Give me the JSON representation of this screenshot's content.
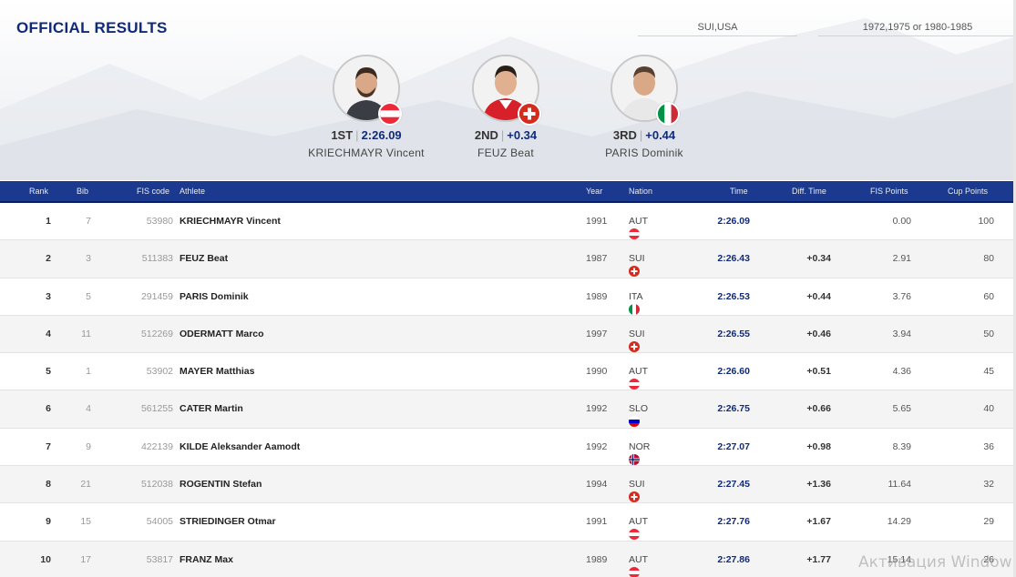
{
  "page_title": "OFFICIAL RESULTS",
  "filters": {
    "nation": "SUI,USA",
    "year": "1972,1975 or 1980-1985"
  },
  "podium": [
    {
      "place": "1ST",
      "value": "2:26.09",
      "name": "KRIECHMAYR Vincent",
      "flag": "flag-austria-icon"
    },
    {
      "place": "2ND",
      "value": "+0.34",
      "name": "FEUZ Beat",
      "flag": "flag-switzerland-icon"
    },
    {
      "place": "3RD",
      "value": "+0.44",
      "name": "PARIS Dominik",
      "flag": "flag-italy-icon"
    }
  ],
  "table": {
    "headers": {
      "rank": "Rank",
      "bib": "Bib",
      "fis_code": "FIS code",
      "athlete": "Athlete",
      "year": "Year",
      "nation": "Nation",
      "time": "Time",
      "diff": "Diff. Time",
      "fis_points": "FIS Points",
      "cup_points": "Cup Points"
    },
    "rows": [
      {
        "rank": "1",
        "bib": "7",
        "fis": "53980",
        "athlete": "KRIECHMAYR Vincent",
        "year": "1991",
        "nation": "AUT",
        "time": "2:26.09",
        "diff": "",
        "fisp": "0.00",
        "cup": "100"
      },
      {
        "rank": "2",
        "bib": "3",
        "fis": "511383",
        "athlete": "FEUZ Beat",
        "year": "1987",
        "nation": "SUI",
        "time": "2:26.43",
        "diff": "+0.34",
        "fisp": "2.91",
        "cup": "80"
      },
      {
        "rank": "3",
        "bib": "5",
        "fis": "291459",
        "athlete": "PARIS Dominik",
        "year": "1989",
        "nation": "ITA",
        "time": "2:26.53",
        "diff": "+0.44",
        "fisp": "3.76",
        "cup": "60"
      },
      {
        "rank": "4",
        "bib": "11",
        "fis": "512269",
        "athlete": "ODERMATT Marco",
        "year": "1997",
        "nation": "SUI",
        "time": "2:26.55",
        "diff": "+0.46",
        "fisp": "3.94",
        "cup": "50"
      },
      {
        "rank": "5",
        "bib": "1",
        "fis": "53902",
        "athlete": "MAYER Matthias",
        "year": "1990",
        "nation": "AUT",
        "time": "2:26.60",
        "diff": "+0.51",
        "fisp": "4.36",
        "cup": "45"
      },
      {
        "rank": "6",
        "bib": "4",
        "fis": "561255",
        "athlete": "CATER Martin",
        "year": "1992",
        "nation": "SLO",
        "time": "2:26.75",
        "diff": "+0.66",
        "fisp": "5.65",
        "cup": "40"
      },
      {
        "rank": "7",
        "bib": "9",
        "fis": "422139",
        "athlete": "KILDE Aleksander Aamodt",
        "year": "1992",
        "nation": "NOR",
        "time": "2:27.07",
        "diff": "+0.98",
        "fisp": "8.39",
        "cup": "36"
      },
      {
        "rank": "8",
        "bib": "21",
        "fis": "512038",
        "athlete": "ROGENTIN Stefan",
        "year": "1994",
        "nation": "SUI",
        "time": "2:27.45",
        "diff": "+1.36",
        "fisp": "11.64",
        "cup": "32"
      },
      {
        "rank": "9",
        "bib": "15",
        "fis": "54005",
        "athlete": "STRIEDINGER Otmar",
        "year": "1991",
        "nation": "AUT",
        "time": "2:27.76",
        "diff": "+1.67",
        "fisp": "14.29",
        "cup": "29"
      },
      {
        "rank": "10",
        "bib": "17",
        "fis": "53817",
        "athlete": "FRANZ Max",
        "year": "1989",
        "nation": "AUT",
        "time": "2:27.86",
        "diff": "+1.77",
        "fisp": "15.14",
        "cup": "26"
      }
    ]
  },
  "watermark": "Активация Window",
  "colors": {
    "header_bg": "#1b3a8f",
    "title": "#102a7a",
    "time": "#102a7a"
  }
}
